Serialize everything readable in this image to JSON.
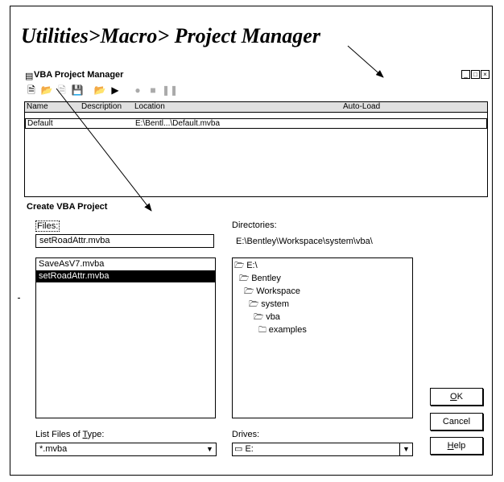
{
  "heading": "Utilities>Macro> Project Manager",
  "vba_window": {
    "title": "VBA Project Manager",
    "columns": [
      "Name",
      "Description",
      "Location",
      "Auto-Load"
    ],
    "rows": [
      {
        "name": "Default",
        "description": "",
        "location": "E:\\Bentl...\\Default.mvba",
        "auto_load": ""
      }
    ]
  },
  "dialog": {
    "title": "Create VBA Project",
    "files_label": "Files:",
    "file_name": "setRoadAttr.mvba",
    "files": [
      "SaveAsV7.mvba",
      "setRoadAttr.mvba"
    ],
    "selected_file_index": 1,
    "directories_label": "Directories:",
    "current_dir": "E:\\Bentley\\Workspace\\system\\vba\\",
    "dir_tree": [
      {
        "label": "E:\\",
        "level": 0
      },
      {
        "label": "Bentley",
        "level": 1
      },
      {
        "label": "Workspace",
        "level": 2
      },
      {
        "label": "system",
        "level": 3
      },
      {
        "label": "vba",
        "level": 4
      },
      {
        "label": "examples",
        "level": 5
      }
    ],
    "list_type_label_pre": "List Files of ",
    "list_type_label_key": "T",
    "list_type_label_post": "ype:",
    "list_type_value": "*.mvba",
    "drives_label": "Drives:",
    "drive_value": "E:",
    "ok_key": "O",
    "ok_rest": "K",
    "cancel_label": "Cancel",
    "help_key": "H",
    "help_rest": "elp"
  }
}
